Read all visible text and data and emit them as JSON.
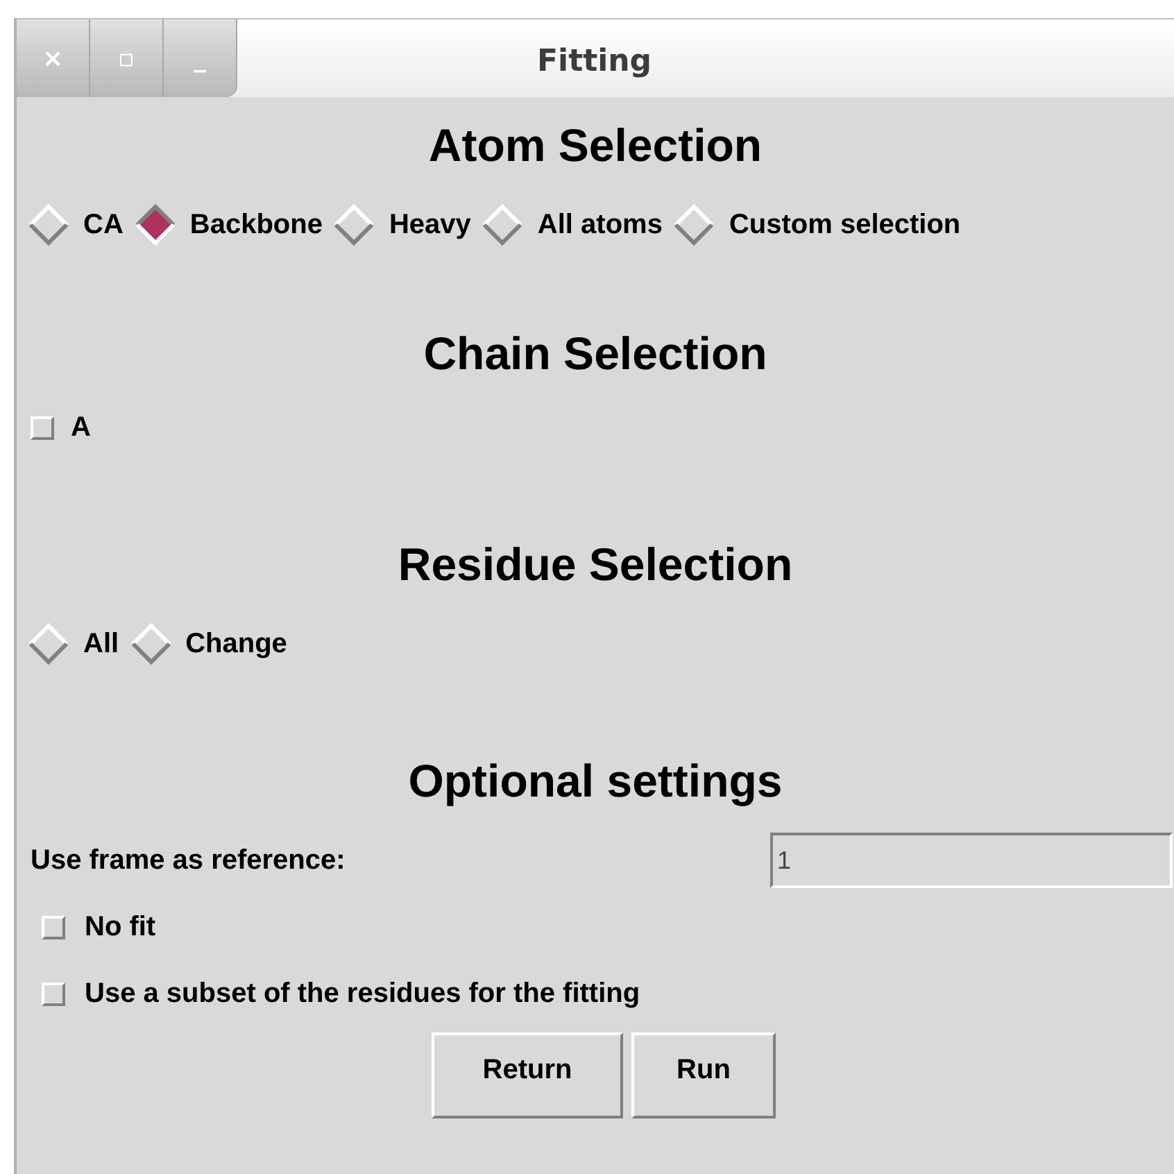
{
  "window": {
    "title": "Fitting",
    "controls": [
      "×",
      "▫",
      "_"
    ]
  },
  "atom_selection": {
    "heading": "Atom Selection",
    "options": [
      {
        "label": "CA",
        "selected": false
      },
      {
        "label": "Backbone",
        "selected": true
      },
      {
        "label": "Heavy",
        "selected": false
      },
      {
        "label": "All atoms",
        "selected": false
      },
      {
        "label": "Custom selection",
        "selected": false
      }
    ]
  },
  "chain_selection": {
    "heading": "Chain Selection",
    "chains": [
      {
        "label": "A",
        "checked": false
      }
    ]
  },
  "residue_selection": {
    "heading": "Residue Selection",
    "options": [
      {
        "label": "All",
        "selected": false
      },
      {
        "label": "Change",
        "selected": false
      }
    ]
  },
  "optional_settings": {
    "heading": "Optional settings",
    "reference_frame": {
      "label": "Use frame as reference:",
      "value": "1"
    },
    "options": [
      {
        "label": "No fit",
        "checked": false
      },
      {
        "label": "Use a subset of the residues for the fitting",
        "checked": false
      }
    ]
  },
  "buttons": [
    "Return",
    "Run"
  ]
}
